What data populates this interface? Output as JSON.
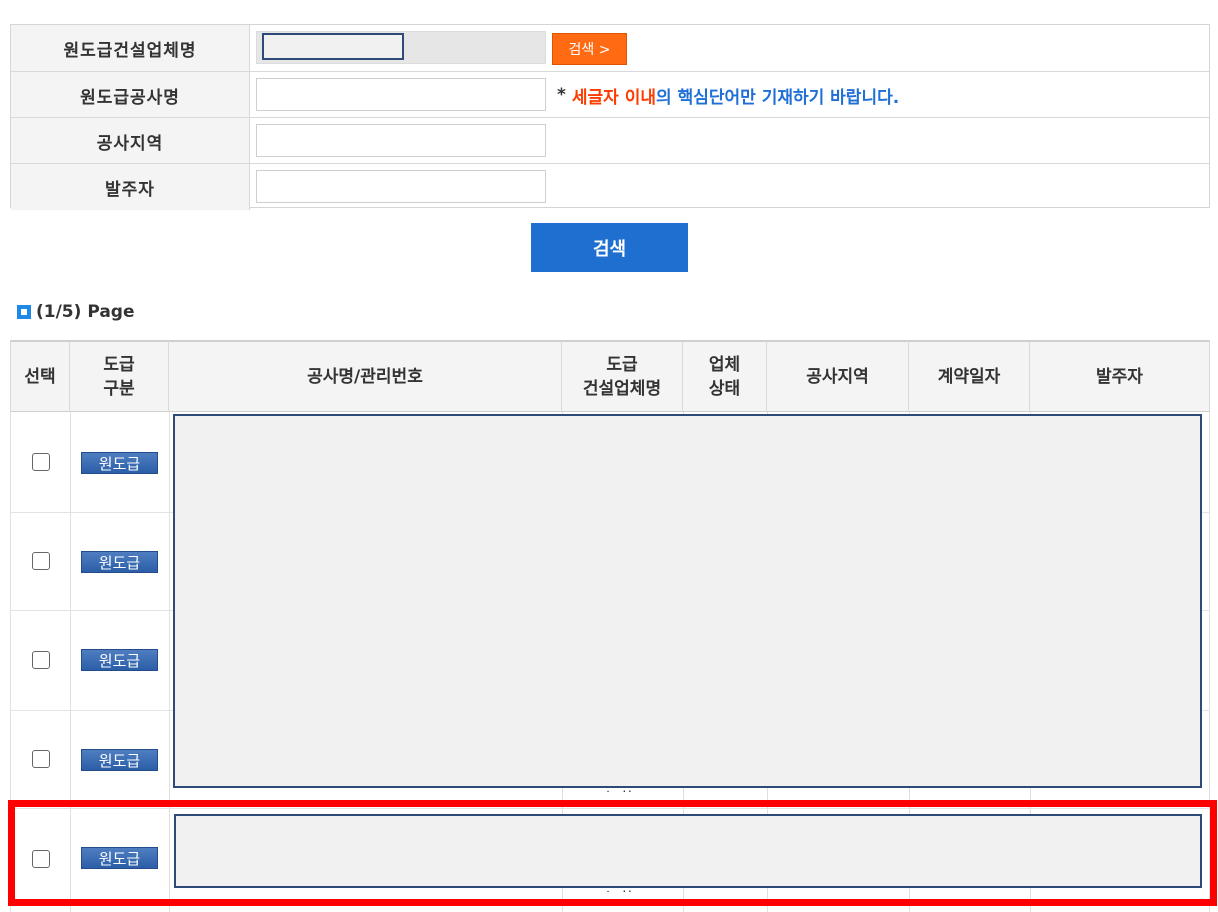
{
  "search_form": {
    "contractor_label": "원도급건설업체명",
    "search_button_small": "검색 >",
    "project_label": "원도급공사명",
    "hint_star": "*",
    "hint_red": "세글자 이내",
    "hint_blue": "의 핵심단어만 기재하기 바랍니다.",
    "region_label": "공사지역",
    "client_label": "발주자",
    "project_value": "",
    "region_value": "",
    "client_value": ""
  },
  "search_button": "검색",
  "page_indicator": "(1/5) Page",
  "results": {
    "headers": [
      "선택",
      "도급\n구분",
      "공사명/관리번호",
      "도급\n건설업체명",
      "업체\n상태",
      "공사지역",
      "계약일자",
      "발주자"
    ],
    "rows": [
      {
        "type": "원도급",
        "checked": false
      },
      {
        "type": "원도급",
        "checked": false
      },
      {
        "type": "원도급",
        "checked": false
      },
      {
        "type": "원도급",
        "checked": false
      },
      {
        "type": "원도급",
        "checked": false
      }
    ],
    "partial_text": [
      "ᄂᄊ",
      "ᄂᄊ"
    ]
  },
  "colors": {
    "orange_button": "#ff6a13",
    "blue_button": "#1e6fcf",
    "hint_red": "#ff3c00",
    "hint_blue": "#1f6fd6",
    "highlight_red": "#ff0000",
    "redaction_border": "#2f4a7a"
  }
}
